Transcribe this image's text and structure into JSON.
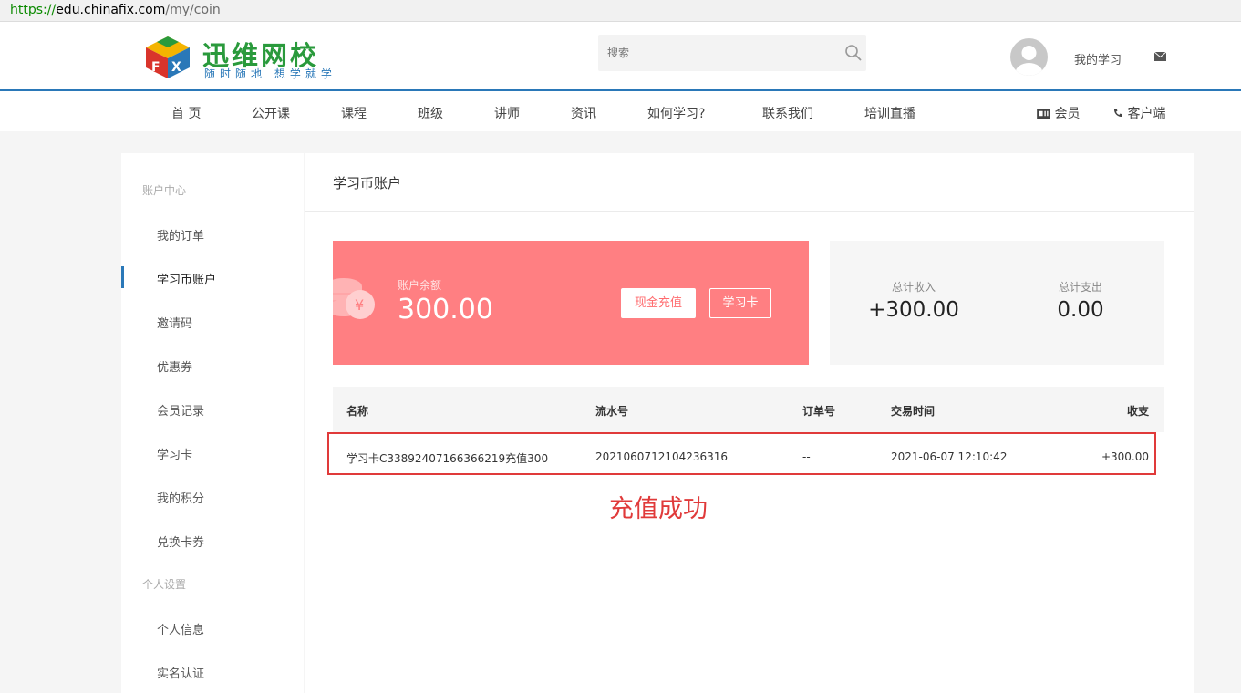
{
  "browser": {
    "url_scheme": "https://",
    "url_host": "edu.chinafix.com",
    "url_path": "/my/coin"
  },
  "header": {
    "brand": "迅维网校",
    "slogan": "随时随地 想学就学",
    "search_placeholder": "搜索",
    "my_learning": "我的学习"
  },
  "nav": {
    "items": [
      "首 页",
      "公开课",
      "课程",
      "班级",
      "讲师",
      "资讯",
      "如何学习?",
      "联系我们",
      "培训直播"
    ],
    "member": "会员",
    "client": "客户端"
  },
  "sidebar": {
    "group_account": "账户中心",
    "group_personal": "个人设置",
    "links": [
      "我的订单",
      "学习币账户",
      "邀请码",
      "优惠券",
      "会员记录",
      "学习卡",
      "我的积分",
      "兑换卡券"
    ],
    "personal_links": [
      "个人信息",
      "实名认证"
    ],
    "active_index": 1
  },
  "main": {
    "title": "学习币账户",
    "balance_label": "账户余额",
    "balance_value": "300.00",
    "cash_recharge": "现金充值",
    "study_card": "学习卡",
    "total_income_label": "总计收入",
    "total_income_value": "+300.00",
    "total_expense_label": "总计支出",
    "total_expense_value": "0.00"
  },
  "table": {
    "headers": [
      "名称",
      "流水号",
      "订单号",
      "交易时间",
      "收支"
    ],
    "rows": [
      [
        "学习卡C33892407166366219充值300",
        "2021060712104236316",
        "--",
        "2021-06-07 12:10:42",
        "+300.00"
      ]
    ]
  },
  "annotation": {
    "text": "充值成功",
    "color": "#e03a3a"
  },
  "colors": {
    "accent": "#2a78b8",
    "balance_card": "#ff7f82",
    "brand_green": "#2a9a3c"
  }
}
